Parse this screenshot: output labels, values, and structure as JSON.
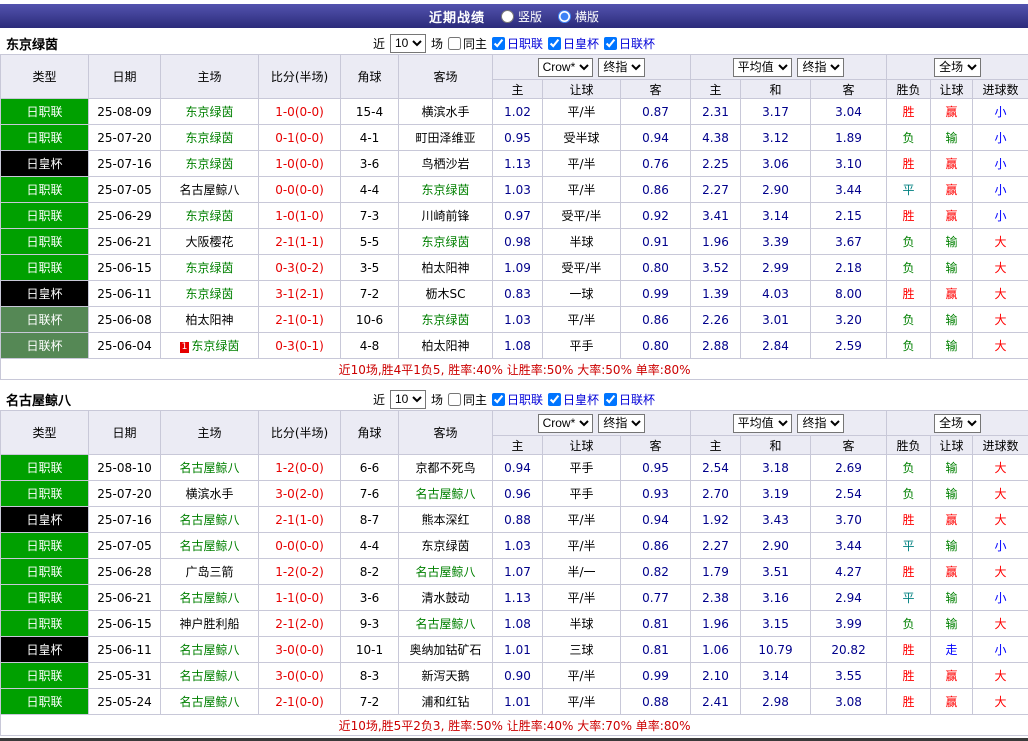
{
  "page": {
    "title": "近期战绩",
    "view_options": [
      {
        "label": "竖版",
        "selected": false
      },
      {
        "label": "横版",
        "selected": true
      }
    ]
  },
  "colors": {
    "topbar": "#32327e",
    "header_bg": "#ebebf4",
    "team_highlight": "#008000",
    "score": "#e60000",
    "odds": "#00008b",
    "summary": "#cc0000",
    "league": {
      "日职联": "#00a000",
      "日皇杯": "#000000",
      "日联杯": "#558855"
    },
    "result": {
      "胜": "#ff0000",
      "负": "#008000",
      "平": "#008080",
      "赢": "#ff0000",
      "输": "#008000",
      "走": "#0000ff",
      "大": "#ff0000",
      "小": "#0000ff"
    }
  },
  "filters": {
    "near_label": "近",
    "count_value": "10",
    "games_label": "场",
    "checkboxes": [
      {
        "label": "同主",
        "checked": false
      },
      {
        "label": "日职联",
        "checked": true
      },
      {
        "label": "日皇杯",
        "checked": true
      },
      {
        "label": "日联杯",
        "checked": true
      }
    ]
  },
  "table_header": {
    "cols": [
      "类型",
      "日期",
      "主场",
      "比分(半场)",
      "角球",
      "客场"
    ],
    "asian": {
      "select1": "Crow*",
      "select2": "终指",
      "cols": [
        "主",
        "让球",
        "客"
      ]
    },
    "euro": {
      "select1": "平均值",
      "select2": "终指",
      "cols": [
        "主",
        "和",
        "客"
      ]
    },
    "full": {
      "select": "全场",
      "cols": [
        "胜负",
        "让球",
        "进球数"
      ]
    }
  },
  "sections": [
    {
      "team": "东京绿茵",
      "rows": [
        {
          "league": "日职联",
          "date": "25-08-09",
          "home": "东京绿茵",
          "score": "1-0(0-0)",
          "corner": "15-4",
          "away": "横滨水手",
          "ah": [
            "1.02",
            "平/半",
            "0.87"
          ],
          "eu": [
            "2.31",
            "3.17",
            "3.04"
          ],
          "res": [
            "胜",
            "赢",
            "小"
          ]
        },
        {
          "league": "日职联",
          "date": "25-07-20",
          "home": "东京绿茵",
          "score": "0-1(0-0)",
          "corner": "4-1",
          "away": "町田泽维亚",
          "ah": [
            "0.95",
            "受半球",
            "0.94"
          ],
          "eu": [
            "4.38",
            "3.12",
            "1.89"
          ],
          "res": [
            "负",
            "输",
            "小"
          ]
        },
        {
          "league": "日皇杯",
          "date": "25-07-16",
          "home": "东京绿茵",
          "score": "1-0(0-0)",
          "corner": "3-6",
          "away": "鸟栖沙岩",
          "ah": [
            "1.13",
            "平/半",
            "0.76"
          ],
          "eu": [
            "2.25",
            "3.06",
            "3.10"
          ],
          "res": [
            "胜",
            "赢",
            "小"
          ]
        },
        {
          "league": "日职联",
          "date": "25-07-05",
          "home": "名古屋鲸八",
          "score": "0-0(0-0)",
          "corner": "4-4",
          "away": "东京绿茵",
          "ah": [
            "1.03",
            "平/半",
            "0.86"
          ],
          "eu": [
            "2.27",
            "2.90",
            "3.44"
          ],
          "res": [
            "平",
            "赢",
            "小"
          ]
        },
        {
          "league": "日职联",
          "date": "25-06-29",
          "home": "东京绿茵",
          "score": "1-0(1-0)",
          "corner": "7-3",
          "away": "川崎前锋",
          "ah": [
            "0.97",
            "受平/半",
            "0.92"
          ],
          "eu": [
            "3.41",
            "3.14",
            "2.15"
          ],
          "res": [
            "胜",
            "赢",
            "小"
          ]
        },
        {
          "league": "日职联",
          "date": "25-06-21",
          "home": "大阪樱花",
          "score": "2-1(1-1)",
          "corner": "5-5",
          "away": "东京绿茵",
          "ah": [
            "0.98",
            "半球",
            "0.91"
          ],
          "eu": [
            "1.96",
            "3.39",
            "3.67"
          ],
          "res": [
            "负",
            "输",
            "大"
          ]
        },
        {
          "league": "日职联",
          "date": "25-06-15",
          "home": "东京绿茵",
          "score": "0-3(0-2)",
          "corner": "3-5",
          "away": "柏太阳神",
          "ah": [
            "1.09",
            "受平/半",
            "0.80"
          ],
          "eu": [
            "3.52",
            "2.99",
            "2.18"
          ],
          "res": [
            "负",
            "输",
            "大"
          ]
        },
        {
          "league": "日皇杯",
          "date": "25-06-11",
          "home": "东京绿茵",
          "score": "3-1(2-1)",
          "corner": "7-2",
          "away": "枥木SC",
          "ah": [
            "0.83",
            "一球",
            "0.99"
          ],
          "eu": [
            "1.39",
            "4.03",
            "8.00"
          ],
          "res": [
            "胜",
            "赢",
            "大"
          ]
        },
        {
          "league": "日联杯",
          "date": "25-06-08",
          "home": "柏太阳神",
          "score": "2-1(0-1)",
          "corner": "10-6",
          "away": "东京绿茵",
          "ah": [
            "1.03",
            "平/半",
            "0.86"
          ],
          "eu": [
            "2.26",
            "3.01",
            "3.20"
          ],
          "res": [
            "负",
            "输",
            "大"
          ]
        },
        {
          "league": "日联杯",
          "date": "25-06-04",
          "home": "东京绿茵",
          "home_card": "1",
          "score": "0-3(0-1)",
          "corner": "4-8",
          "away": "柏太阳神",
          "ah": [
            "1.08",
            "平手",
            "0.80"
          ],
          "eu": [
            "2.88",
            "2.84",
            "2.59"
          ],
          "res": [
            "负",
            "输",
            "大"
          ]
        }
      ],
      "summary": "近10场,胜4平1负5, 胜率:40% 让胜率:50% 大率:50% 单率:80%"
    },
    {
      "team": "名古屋鲸八",
      "rows": [
        {
          "league": "日职联",
          "date": "25-08-10",
          "home": "名古屋鲸八",
          "score": "1-2(0-0)",
          "corner": "6-6",
          "away": "京都不死鸟",
          "ah": [
            "0.94",
            "平手",
            "0.95"
          ],
          "eu": [
            "2.54",
            "3.18",
            "2.69"
          ],
          "res": [
            "负",
            "输",
            "大"
          ]
        },
        {
          "league": "日职联",
          "date": "25-07-20",
          "home": "横滨水手",
          "score": "3-0(2-0)",
          "corner": "7-6",
          "away": "名古屋鲸八",
          "ah": [
            "0.96",
            "平手",
            "0.93"
          ],
          "eu": [
            "2.70",
            "3.19",
            "2.54"
          ],
          "res": [
            "负",
            "输",
            "大"
          ]
        },
        {
          "league": "日皇杯",
          "date": "25-07-16",
          "home": "名古屋鲸八",
          "score": "2-1(1-0)",
          "corner": "8-7",
          "away": "熊本深红",
          "ah": [
            "0.88",
            "平/半",
            "0.94"
          ],
          "eu": [
            "1.92",
            "3.43",
            "3.70"
          ],
          "res": [
            "胜",
            "赢",
            "大"
          ]
        },
        {
          "league": "日职联",
          "date": "25-07-05",
          "home": "名古屋鲸八",
          "score": "0-0(0-0)",
          "corner": "4-4",
          "away": "东京绿茵",
          "ah": [
            "1.03",
            "平/半",
            "0.86"
          ],
          "eu": [
            "2.27",
            "2.90",
            "3.44"
          ],
          "res": [
            "平",
            "输",
            "小"
          ]
        },
        {
          "league": "日职联",
          "date": "25-06-28",
          "home": "广岛三箭",
          "score": "1-2(0-2)",
          "corner": "8-2",
          "away": "名古屋鲸八",
          "ah": [
            "1.07",
            "半/一",
            "0.82"
          ],
          "eu": [
            "1.79",
            "3.51",
            "4.27"
          ],
          "res": [
            "胜",
            "赢",
            "大"
          ]
        },
        {
          "league": "日职联",
          "date": "25-06-21",
          "home": "名古屋鲸八",
          "score": "1-1(0-0)",
          "corner": "3-6",
          "away": "清水鼓动",
          "ah": [
            "1.13",
            "平/半",
            "0.77"
          ],
          "eu": [
            "2.38",
            "3.16",
            "2.94"
          ],
          "res": [
            "平",
            "输",
            "小"
          ]
        },
        {
          "league": "日职联",
          "date": "25-06-15",
          "home": "神户胜利船",
          "score": "2-1(2-0)",
          "corner": "9-3",
          "away": "名古屋鲸八",
          "ah": [
            "1.08",
            "半球",
            "0.81"
          ],
          "eu": [
            "1.96",
            "3.15",
            "3.99"
          ],
          "res": [
            "负",
            "输",
            "大"
          ]
        },
        {
          "league": "日皇杯",
          "date": "25-06-11",
          "home": "名古屋鲸八",
          "score": "3-0(0-0)",
          "corner": "10-1",
          "away": "奥纳加钴矿石",
          "ah": [
            "1.01",
            "三球",
            "0.81"
          ],
          "eu": [
            "1.06",
            "10.79",
            "20.82"
          ],
          "res": [
            "胜",
            "走",
            "小"
          ]
        },
        {
          "league": "日职联",
          "date": "25-05-31",
          "home": "名古屋鲸八",
          "score": "3-0(0-0)",
          "corner": "8-3",
          "away": "新泻天鹅",
          "ah": [
            "0.90",
            "平/半",
            "0.99"
          ],
          "eu": [
            "2.10",
            "3.14",
            "3.55"
          ],
          "res": [
            "胜",
            "赢",
            "大"
          ]
        },
        {
          "league": "日职联",
          "date": "25-05-24",
          "home": "名古屋鲸八",
          "score": "2-1(0-0)",
          "corner": "7-2",
          "away": "浦和红钻",
          "ah": [
            "1.01",
            "平/半",
            "0.88"
          ],
          "eu": [
            "2.41",
            "2.98",
            "3.08"
          ],
          "res": [
            "胜",
            "赢",
            "大"
          ]
        }
      ],
      "summary": "近10场,胜5平2负3, 胜率:50% 让胜率:40% 大率:70% 单率:80%"
    }
  ]
}
